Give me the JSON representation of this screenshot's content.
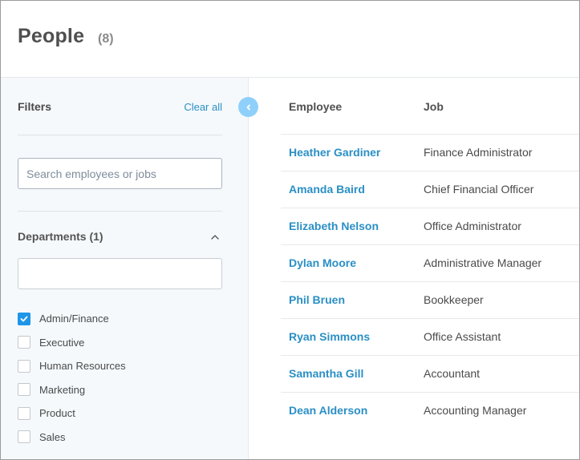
{
  "header": {
    "title": "People",
    "count": "(8)"
  },
  "sidebar": {
    "filters_title": "Filters",
    "clear_all_label": "Clear all",
    "search": {
      "placeholder": "Search employees or jobs",
      "value": ""
    },
    "departments": {
      "title": "Departments (1)",
      "expanded": true,
      "filter_value": "",
      "options": [
        {
          "label": "Admin/Finance",
          "checked": true
        },
        {
          "label": "Executive",
          "checked": false
        },
        {
          "label": "Human Resources",
          "checked": false
        },
        {
          "label": "Marketing",
          "checked": false
        },
        {
          "label": "Product",
          "checked": false
        },
        {
          "label": "Sales",
          "checked": false
        }
      ]
    },
    "collapse_icon": "chevron-left-icon"
  },
  "table": {
    "columns": [
      "Employee",
      "Job"
    ],
    "rows": [
      {
        "employee": "Heather Gardiner",
        "job": "Finance Administrator"
      },
      {
        "employee": "Amanda Baird",
        "job": "Chief Financial Officer"
      },
      {
        "employee": "Elizabeth Nelson",
        "job": "Office Administrator"
      },
      {
        "employee": "Dylan Moore",
        "job": "Administrative Manager"
      },
      {
        "employee": "Phil Bruen",
        "job": "Bookkeeper"
      },
      {
        "employee": "Ryan Simmons",
        "job": "Office Assistant"
      },
      {
        "employee": "Samantha Gill",
        "job": "Accountant"
      },
      {
        "employee": "Dean Alderson",
        "job": "Accounting Manager"
      }
    ]
  },
  "colors": {
    "link": "#2a8fc5",
    "checkbox_checked": "#1e96e8",
    "collapse_button": "#8fd0fb",
    "sidebar_bg": "#f5f9fc"
  }
}
